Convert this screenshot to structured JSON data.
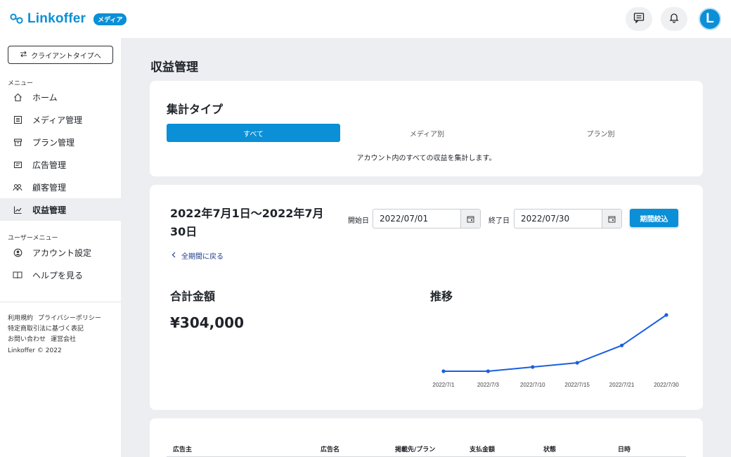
{
  "header": {
    "logo_text": "Linkoffer",
    "logo_badge": "メディア",
    "avatar_letter": "L",
    "icons": [
      "chat-icon",
      "bell-icon"
    ]
  },
  "sidebar": {
    "switch_label": "クライアントタイプへ",
    "menu_label": "メニュー",
    "items": [
      {
        "label": "ホーム",
        "icon": "home-icon"
      },
      {
        "label": "メディア管理",
        "icon": "media-icon"
      },
      {
        "label": "プラン管理",
        "icon": "box-icon"
      },
      {
        "label": "広告管理",
        "icon": "ad-icon"
      },
      {
        "label": "顧客管理",
        "icon": "customers-icon"
      },
      {
        "label": "収益管理",
        "icon": "chart-line-icon",
        "active": true
      }
    ],
    "user_menu_label": "ユーザーメニュー",
    "user_items": [
      {
        "label": "アカウント設定",
        "icon": "account-icon"
      },
      {
        "label": "ヘルプを見る",
        "icon": "book-icon"
      }
    ],
    "footer_links": [
      "利用規約",
      "プライバシーポリシー",
      "特定商取引法に基づく表記",
      "お問い合わせ",
      "運営会社"
    ],
    "copyright": "Linkoffer © 2022"
  },
  "page_title": "収益管理",
  "aggregate": {
    "title": "集計タイプ",
    "tabs": [
      "すべて",
      "メディア別",
      "プラン別"
    ],
    "active_tab": 0,
    "description": "アカウント内のすべての収益を集計します。"
  },
  "period": {
    "range_title": "2022年7月1日〜2022年7月30日",
    "start_label": "開始日",
    "start_value": "2022/07/01",
    "end_label": "終了日",
    "end_value": "2022/07/30",
    "filter_button": "期間絞込",
    "back_link": "全期間に戻る",
    "total_label": "合計金額",
    "total_value": "¥304,000",
    "trend_label": "推移"
  },
  "chart_data": {
    "type": "line",
    "x": [
      "2022/7/1",
      "2022/7/3",
      "2022/7/10",
      "2022/7/15",
      "2022/7/21",
      "2022/7/30"
    ],
    "values": [
      0,
      0,
      18000,
      36000,
      110000,
      240000
    ],
    "color": "#1a5fe0",
    "ylim": [
      0,
      240000
    ],
    "grid": false
  },
  "table": {
    "headers": [
      "広告主",
      "広告名",
      "掲載先/プラン",
      "支払金額",
      "状態",
      "日時"
    ]
  }
}
